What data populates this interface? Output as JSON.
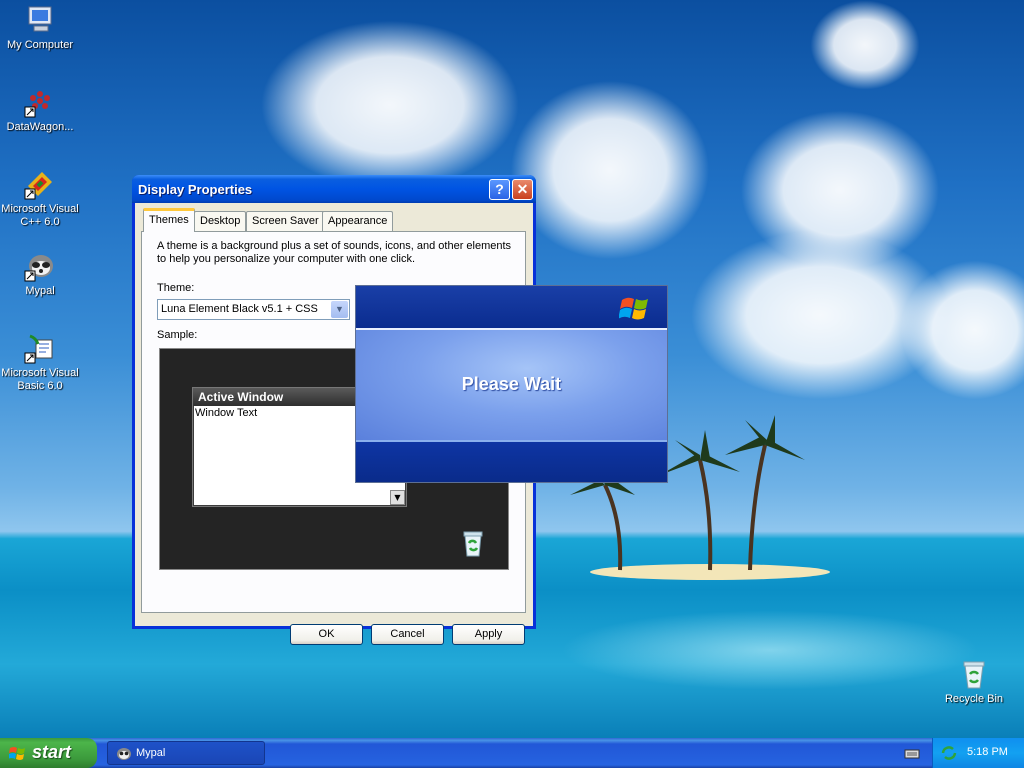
{
  "desktop": {
    "icons": [
      {
        "label": "My Computer",
        "icon": "my-computer-icon"
      },
      {
        "label": "DataWagon...",
        "icon": "datawagon-icon"
      },
      {
        "label": "Microsoft Visual C++ 6.0",
        "icon": "visual-cpp-icon"
      },
      {
        "label": "Mypal",
        "icon": "mypal-icon"
      },
      {
        "label": "Microsoft Visual Basic 6.0",
        "icon": "visual-basic-icon"
      },
      {
        "label": "Recycle Bin",
        "icon": "recycle-bin-icon"
      }
    ]
  },
  "display_properties": {
    "title": "Display Properties",
    "tabs": [
      {
        "label": "Themes",
        "active": true
      },
      {
        "label": "Desktop",
        "active": false
      },
      {
        "label": "Screen Saver",
        "active": false
      },
      {
        "label": "Appearance",
        "active": false
      }
    ],
    "description": "A theme is a background plus a set of sounds, icons, and other elements to help you personalize your computer with one click.",
    "theme_label": "Theme:",
    "theme_value": "Luna Element Black v5.1 + CSS",
    "sample_label": "Sample:",
    "sample": {
      "window_title": "Active Window",
      "window_text": "Window Text"
    },
    "buttons": {
      "ok": "OK",
      "cancel": "Cancel",
      "apply": "Apply"
    }
  },
  "please_wait": {
    "text": "Please Wait"
  },
  "taskbar": {
    "start_label": "start",
    "tasks": [
      {
        "label": "Mypal",
        "icon": "mypal-icon"
      }
    ],
    "clock": "5:18 PM"
  },
  "colors": {
    "xp_blue": "#0054e3",
    "start_green": "#3c9a3c",
    "tray_blue": "#13a1f1"
  }
}
